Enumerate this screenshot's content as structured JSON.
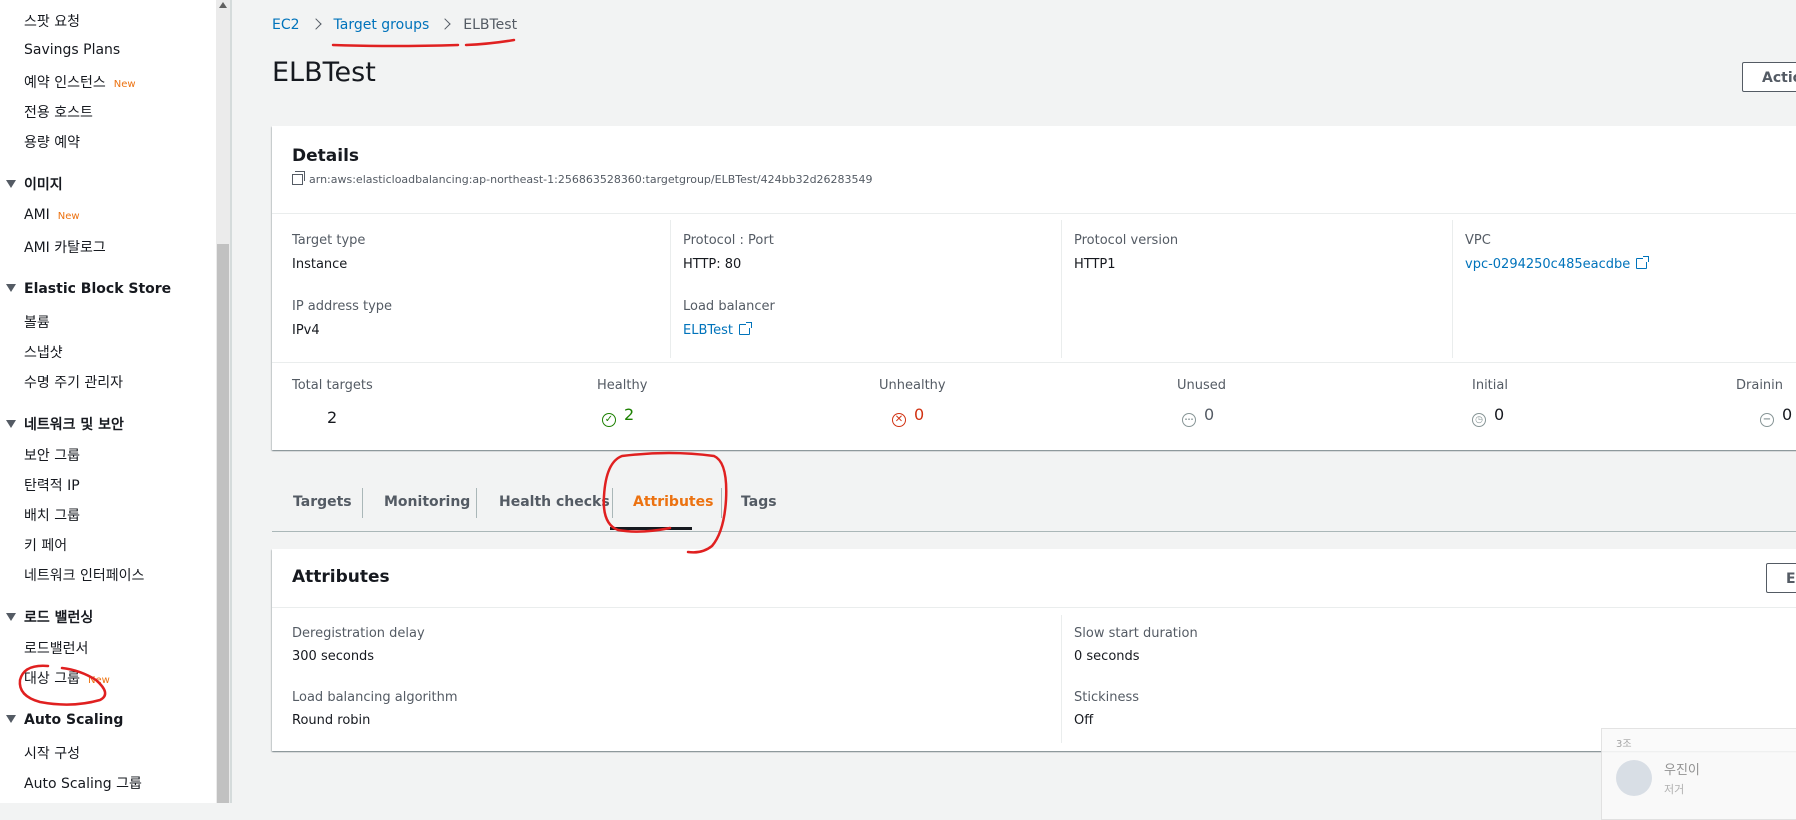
{
  "sidebar": {
    "items": [
      {
        "label": "스팟 요청"
      },
      {
        "label": "Savings Plans"
      },
      {
        "label": "예약 인스턴스",
        "badge": "New"
      },
      {
        "label": "전용 호스트"
      },
      {
        "label": "용량 예약"
      }
    ],
    "groups": [
      {
        "label": "이미지",
        "items": [
          {
            "label": "AMI",
            "badge": "New"
          },
          {
            "label": "AMI 카탈로그"
          }
        ]
      },
      {
        "label": "Elastic Block Store",
        "items": [
          {
            "label": "볼륨"
          },
          {
            "label": "스냅샷"
          },
          {
            "label": "수명 주기 관리자"
          }
        ]
      },
      {
        "label": "네트워크 및 보안",
        "items": [
          {
            "label": "보안 그룹"
          },
          {
            "label": "탄력적 IP"
          },
          {
            "label": "배치 그룹"
          },
          {
            "label": "키 페어"
          },
          {
            "label": "네트워크 인터페이스"
          }
        ]
      },
      {
        "label": "로드 밸런싱",
        "items": [
          {
            "label": "로드밸런서"
          },
          {
            "label": "대상 그룹",
            "badge": "New"
          }
        ]
      },
      {
        "label": "Auto Scaling",
        "items": [
          {
            "label": "시작 구성"
          },
          {
            "label": "Auto Scaling 그룹"
          }
        ]
      }
    ]
  },
  "breadcrumb": {
    "root": "EC2",
    "parent": "Target groups",
    "current": "ELBTest"
  },
  "page": {
    "title": "ELBTest",
    "actions_label": "Actio"
  },
  "details": {
    "title": "Details",
    "arn": "arn:aws:elasticloadbalancing:ap-northeast-1:256863528360:targetgroup/ELBTest/424bb32d26283549",
    "target_type": {
      "label": "Target type",
      "value": "Instance"
    },
    "protocol_port": {
      "label": "Protocol : Port",
      "value": "HTTP: 80"
    },
    "protocol_version": {
      "label": "Protocol version",
      "value": "HTTP1"
    },
    "vpc": {
      "label": "VPC",
      "value": "vpc-0294250c485eacdbe"
    },
    "ip_address_type": {
      "label": "IP address type",
      "value": "IPv4"
    },
    "load_balancer": {
      "label": "Load balancer",
      "value": "ELBTest"
    }
  },
  "counts": {
    "total": {
      "label": "Total targets",
      "value": "2"
    },
    "healthy": {
      "label": "Healthy",
      "value": "2"
    },
    "unhealthy": {
      "label": "Unhealthy",
      "value": "0"
    },
    "unused": {
      "label": "Unused",
      "value": "0"
    },
    "initial": {
      "label": "Initial",
      "value": "0"
    },
    "draining": {
      "label": "Drainin",
      "value": "0"
    }
  },
  "tabs": [
    "Targets",
    "Monitoring",
    "Health checks",
    "Attributes",
    "Tags"
  ],
  "active_tab": "Attributes",
  "attributes": {
    "title": "Attributes",
    "edit_label": "E",
    "deregistration_delay": {
      "label": "Deregistration delay",
      "value": "300 seconds"
    },
    "slow_start": {
      "label": "Slow start duration",
      "value": "0 seconds"
    },
    "algorithm": {
      "label": "Load balancing algorithm",
      "value": "Round robin"
    },
    "stickiness": {
      "label": "Stickiness",
      "value": "Off"
    }
  },
  "notification": {
    "group": "3조",
    "name": "우진이",
    "message": "저거"
  },
  "colors": {
    "accent": "#ec7211",
    "link": "#0073bb",
    "healthy": "#1d8102",
    "unhealthy": "#d13212",
    "annotation": "#e02020"
  }
}
